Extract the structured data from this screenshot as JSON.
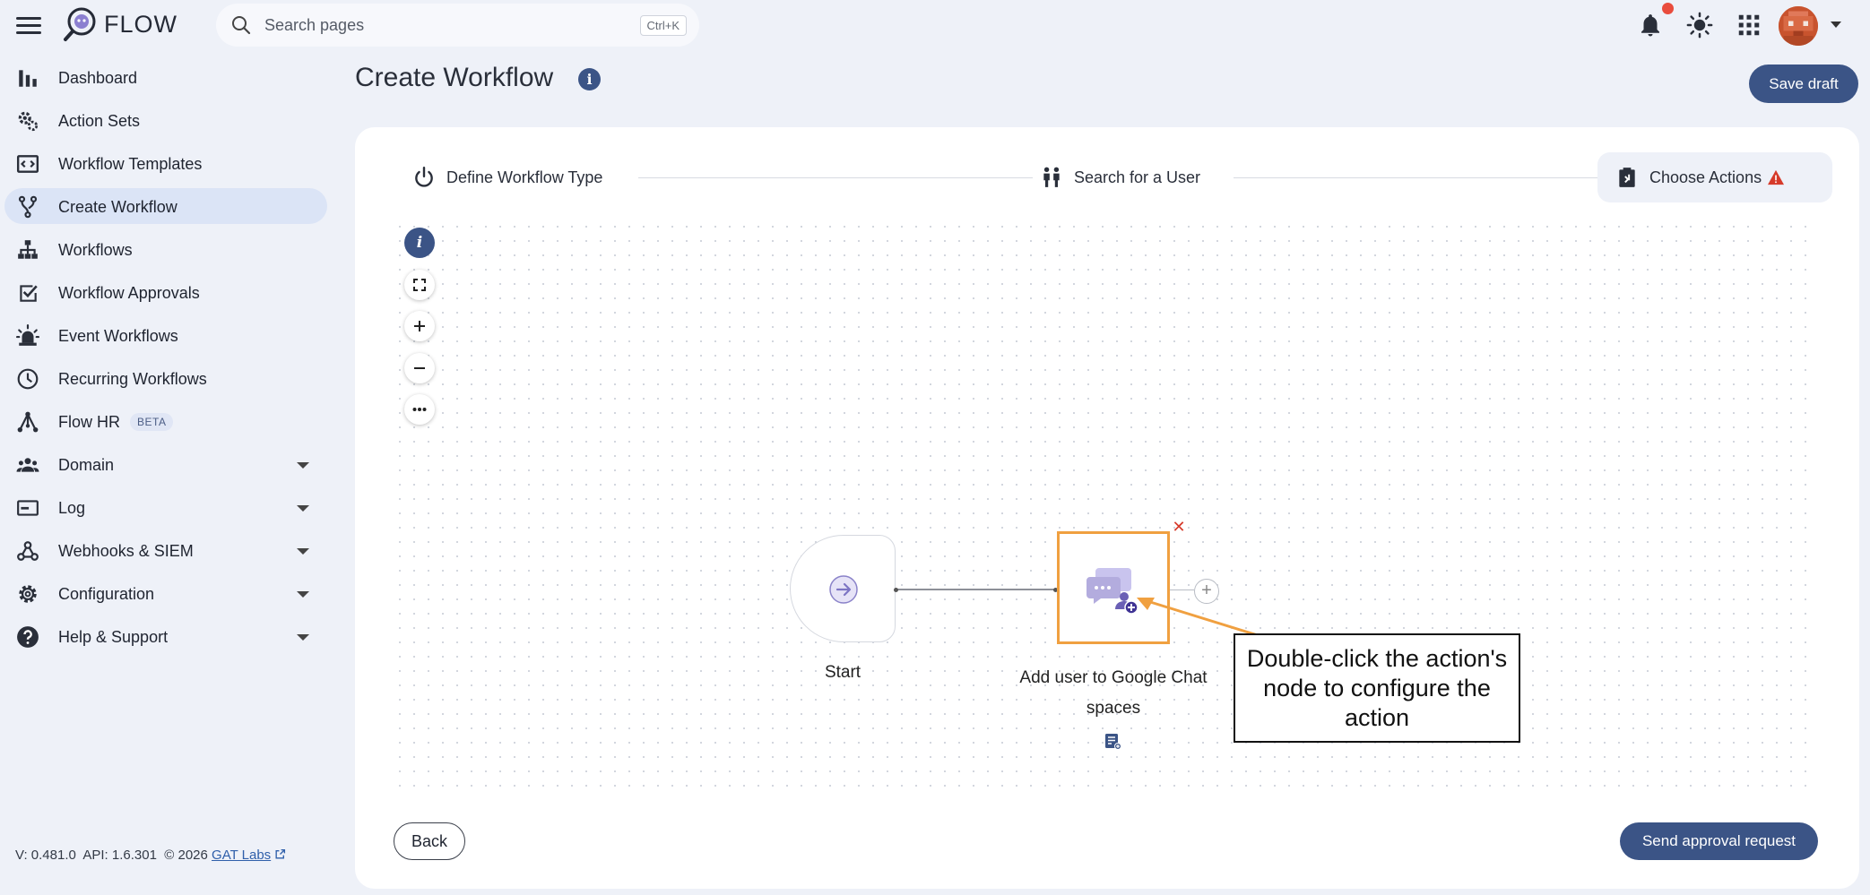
{
  "app": {
    "name": "FLOW"
  },
  "search": {
    "placeholder": "Search pages",
    "shortcut": "Ctrl+K"
  },
  "topbar_icons": [
    "bell-icon",
    "brightness-icon",
    "apps-grid-icon",
    "avatar"
  ],
  "sidebar": {
    "items": [
      {
        "label": "Dashboard",
        "icon": "bar-chart-icon"
      },
      {
        "label": "Action Sets",
        "icon": "gear-sets-icon"
      },
      {
        "label": "Workflow Templates",
        "icon": "template-icon"
      },
      {
        "label": "Create Workflow",
        "icon": "branch-icon",
        "active": true
      },
      {
        "label": "Workflows",
        "icon": "hierarchy-icon"
      },
      {
        "label": "Workflow Approvals",
        "icon": "approval-check-icon"
      },
      {
        "label": "Event Workflows",
        "icon": "alarm-icon"
      },
      {
        "label": "Recurring Workflows",
        "icon": "clock-icon"
      },
      {
        "label": "Flow HR",
        "icon": "flow-hr-icon",
        "badge": "BETA"
      },
      {
        "label": "Domain",
        "icon": "people-icon",
        "expandable": true
      },
      {
        "label": "Log",
        "icon": "log-icon",
        "expandable": true
      },
      {
        "label": "Webhooks & SIEM",
        "icon": "webhook-icon",
        "expandable": true
      },
      {
        "label": "Configuration",
        "icon": "gear-icon",
        "expandable": true
      },
      {
        "label": "Help & Support",
        "icon": "help-icon",
        "expandable": true
      }
    ]
  },
  "footer": {
    "version": "V: 0.481.0",
    "api": "API: 1.6.301",
    "copyright": "© 2026",
    "company": "GAT Labs"
  },
  "page": {
    "title": "Create Workflow",
    "save_draft": "Save draft"
  },
  "stepper": {
    "steps": [
      {
        "label": "Define Workflow Type",
        "icon": "power-icon"
      },
      {
        "label": "Search for a User",
        "icon": "users-icon"
      },
      {
        "label": "Choose Actions",
        "icon": "actions-icon",
        "warning": true
      }
    ]
  },
  "canvas": {
    "start_label": "Start",
    "action_label": "Add user to Google Chat spaces",
    "callout": "Double-click the action's node to configure the action",
    "colors": {
      "highlight": "#f0a040",
      "node_icon": "#7d75c4"
    }
  },
  "buttons": {
    "back": "Back",
    "send": "Send approval request"
  },
  "colors": {
    "primary": "#3b5486",
    "background": "#eef1f8",
    "warning": "#d63a2a"
  }
}
